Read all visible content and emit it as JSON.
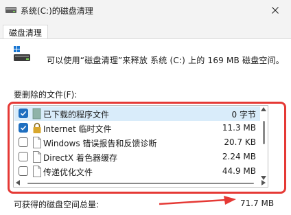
{
  "window": {
    "title": "系统(C:)的磁盘清理",
    "close_icon": "close-icon"
  },
  "tab": {
    "label": "磁盘清理"
  },
  "summary": "可以使用“磁盘清理”来释放 系统 (C:) 上的 169 MB 磁盘空间。",
  "files_label": "要删除的文件(F):",
  "files": [
    {
      "name": "已下载的程序文件",
      "size": "0 字节",
      "checked": true,
      "selected": true,
      "icon": "folder-file-icon"
    },
    {
      "name": "Internet 临时文件",
      "size": "11.3 MB",
      "checked": true,
      "selected": false,
      "icon": "lock-icon"
    },
    {
      "name": "Windows 错误报告和反馈诊断",
      "size": "20.7 KB",
      "checked": false,
      "selected": false,
      "icon": "file-icon"
    },
    {
      "name": "DirectX 着色器缓存",
      "size": "2.24 MB",
      "checked": false,
      "selected": false,
      "icon": "file-icon"
    },
    {
      "name": "传递优化文件",
      "size": "44.9 MB",
      "checked": false,
      "selected": false,
      "icon": "file-icon"
    }
  ],
  "total": {
    "label": "可获得的磁盘空间总量:",
    "value": "71.7 MB"
  },
  "colors": {
    "annotation_red": "#e53935",
    "selection": "#d9ecfa",
    "checkbox_checked": "#1f6fc0"
  }
}
